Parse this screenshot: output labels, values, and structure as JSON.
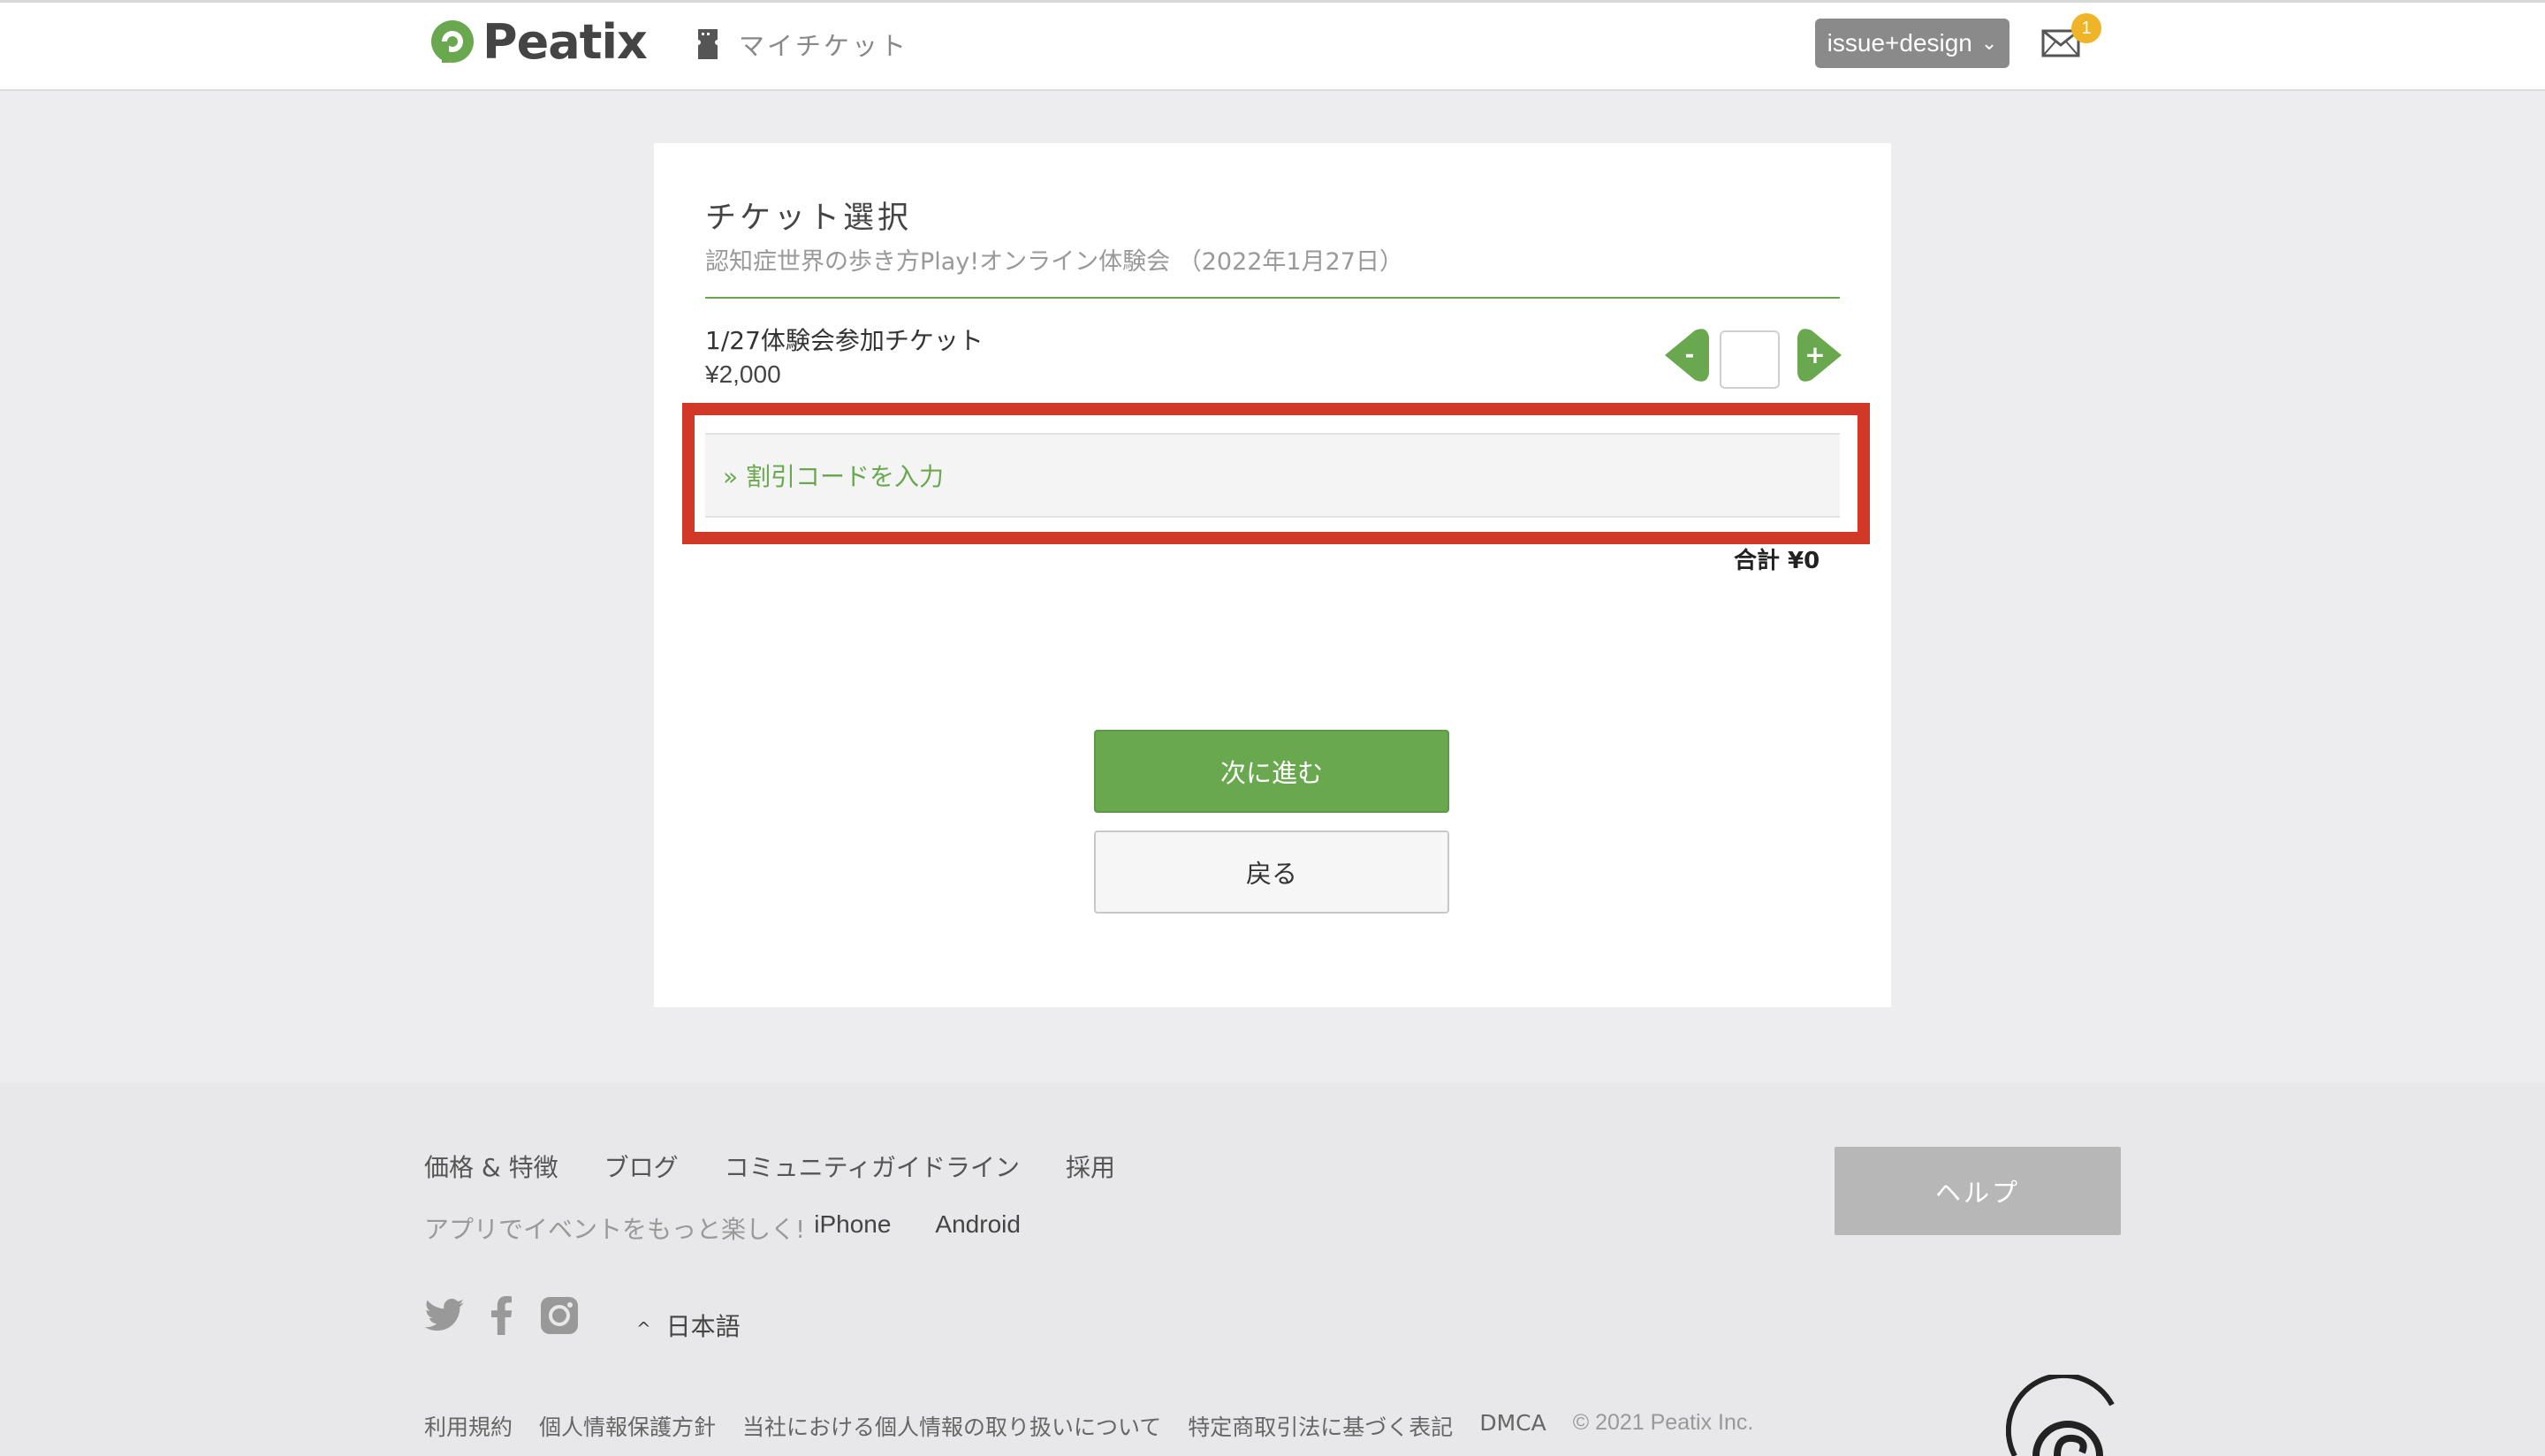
{
  "header": {
    "logo_text": "Peatix",
    "myticket_label": "マイチケット",
    "user_menu_label": "issue+design",
    "mail_badge": "1"
  },
  "card": {
    "title": "チケット選択",
    "subtitle": "認知症世界の歩き方Play!オンライン体験会 （2022年1月27日）",
    "ticket": {
      "name": "1/27体験会参加チケット",
      "price": "¥2,000",
      "quantity": "",
      "minus_label": "-",
      "plus_label": "+"
    },
    "discount_link": "» 割引コードを入力",
    "total": "合計 ¥0",
    "next_button": "次に進む",
    "back_button": "戻る"
  },
  "footer": {
    "links": [
      "価格 & 特徴",
      "ブログ",
      "コミュニティガイドライン",
      "採用"
    ],
    "app_promo": "アプリでイベントをもっと楽しく!",
    "app_links": [
      "iPhone",
      "Android"
    ],
    "help_button": "ヘルプ",
    "social_icons": [
      "twitter-icon",
      "facebook-icon",
      "instagram-icon"
    ],
    "language": "日本語",
    "legal_links": [
      "利用規約",
      "個人情報保護方針",
      "当社における個人情報の取り扱いについて",
      "特定商取引法に基づく表記",
      "DMCA"
    ],
    "copyright": "© 2021 Peatix Inc."
  },
  "colors": {
    "accent_green": "#6aa84f",
    "highlight_red": "#d13826",
    "badge_yellow": "#f0b429"
  }
}
